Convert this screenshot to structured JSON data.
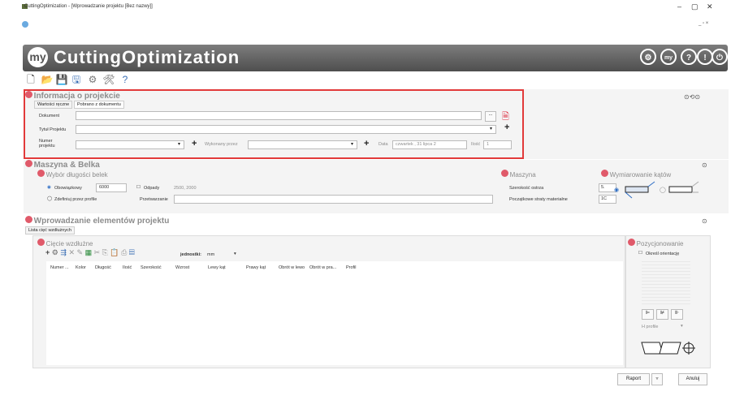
{
  "window": {
    "title": "CuttingOptimization - [Wprowadzanie projektu [Bez nazwy]]"
  },
  "header": {
    "logo_mark": "my",
    "logo_text": "CuttingOptimization"
  },
  "project_info": {
    "title": "Informacja o projekcie",
    "tabs": [
      "Wartości ręczne",
      "Pobrano z dokumentu"
    ],
    "dokument_label": "Dokument",
    "tytul_label": "Tytuł Projektu",
    "numer_label_1": "Numer",
    "numer_label_2": "projektu",
    "wykonany_label": "Wykonany przez",
    "data_label": "Data",
    "date_value": "czwartek , 31 lipca 2",
    "ilosc_label": "Ilość",
    "ilosc_value": "1",
    "browse_label": "..."
  },
  "machine_beam": {
    "title": "Maszyna & Belka",
    "wybor_title": "Wybór długości belek",
    "obowiazkowy_label": "Obowiązkowy",
    "obowiazkowy_value": "6000",
    "odpady_label": "Odpady",
    "odpady_value": "2500, 2000",
    "zdefiniuj_label": "Zdefiniuj przez profile",
    "przetwarzanie_label": "Przetwarzanie",
    "maszyna_title": "Maszyna",
    "szerokosc_label": "Szerokość ostrza",
    "szerokosc_value": "5.",
    "straty_label": "Początkowe straty materiałne",
    "straty_value": "1C",
    "wymiarowanie_title": "Wymiarowanie kątów"
  },
  "elements": {
    "title": "Wprowadzanie elementów projektu",
    "tab": "Lista cięć wzdłużnych",
    "ciecie_title": "Cięcie wzdłużne",
    "jednostki_label": "jednostki:",
    "jednostki_value": "mm",
    "columns": [
      "Numer ...",
      "Kolor",
      "Długość",
      "Ilość",
      "Szerokość",
      "Wzrost",
      "Lewy kąt",
      "Prawy kąt",
      "Obrót w lewo",
      "Obrót w pra...",
      "Profil"
    ],
    "pozycjonowanie_title": "Pozycjonowanie",
    "okresl_label": "Określ orientację",
    "profile_select": "H profile"
  },
  "footer": {
    "raport_label": "Raport",
    "anuluj_label": "Anuluj"
  }
}
